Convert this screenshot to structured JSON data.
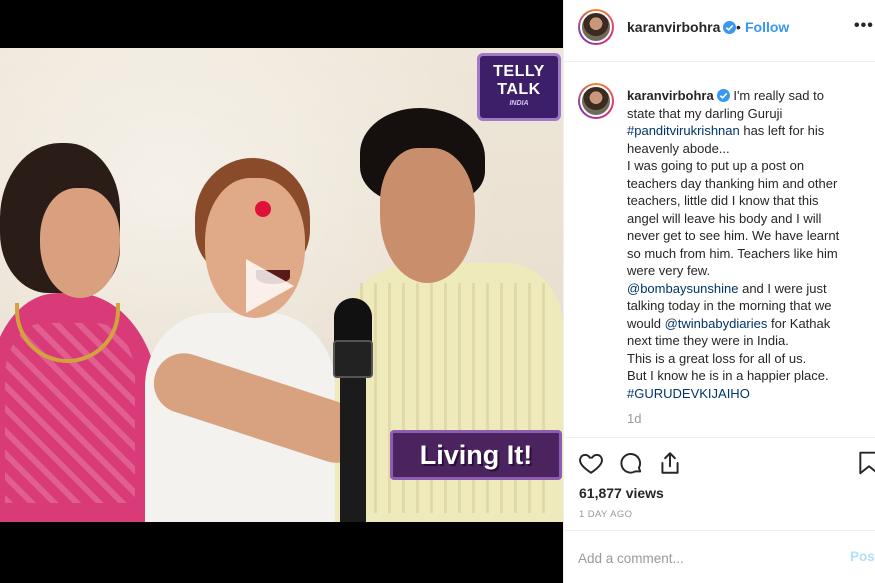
{
  "post": {
    "username": "karanvirbohra",
    "separator": "•",
    "follow_label": "Follow",
    "more_label": "•••",
    "caption_lines": [
      "I'm really sad to",
      "state that my darling Guruji",
      "#panditvirukrishnan",
      " has left for his",
      "heavenly abode...",
      "I was going to put up a post on",
      "teachers day thanking him and other",
      "teachers, little did I know that this",
      "angel will leave his body and I will",
      "never get to see him. We have learnt",
      "so much from him. Teachers like him",
      "were very few.",
      "@bombaysunshine",
      " and I were just",
      "talking today in the morning that we",
      "would ",
      "@twinbabydiaries",
      " for Kathak",
      "next time they were in India.",
      "This is a great loss for all of us.",
      "But I know he is in a happier place.",
      "#GURUDEVKIJAIHO"
    ],
    "time_ago": "1d",
    "views": "61,877 views",
    "date": "1 DAY AGO",
    "comment_placeholder": "Add a comment...",
    "post_label": "Post"
  },
  "media": {
    "logo_line1": "TELLY",
    "logo_line2": "TALK",
    "logo_line3": "INDIA",
    "lower_third": "Living It!"
  },
  "icons": {
    "verified": "verified-badge-icon",
    "like": "heart-icon",
    "comment": "comment-bubble-icon",
    "share": "share-icon",
    "save": "bookmark-icon",
    "play": "play-icon",
    "more": "more-options-icon"
  },
  "colors": {
    "link": "#003569",
    "follow": "#3897f0",
    "verified": "#3897f0",
    "muted": "#999999",
    "post_disabled": "#b2dffc"
  }
}
